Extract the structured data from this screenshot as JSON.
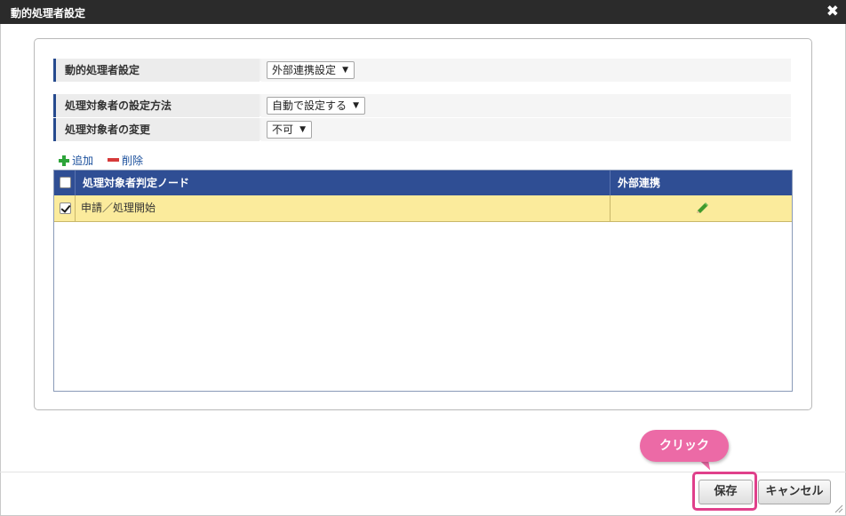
{
  "window": {
    "title": "動的処理者設定",
    "close_glyph": "✖"
  },
  "form": {
    "dynamic_processor": {
      "label": "動的処理者設定",
      "value": "外部連携設定"
    },
    "target_method": {
      "label": "処理対象者の設定方法",
      "value": "自動で設定する"
    },
    "target_change": {
      "label": "処理対象者の変更",
      "value": "不可"
    }
  },
  "toolbar": {
    "add_label": "追加",
    "delete_label": "削除"
  },
  "grid": {
    "columns": [
      "処理対象者判定ノード",
      "外部連携"
    ],
    "rows": [
      {
        "checked": true,
        "node": "申請／処理開始",
        "action_icon": "pencil-icon"
      }
    ]
  },
  "callout": {
    "text": "クリック"
  },
  "footer": {
    "save_label": "保存",
    "cancel_label": "キャンセル"
  },
  "colors": {
    "titlebar": "#2b2b2b",
    "grid_header": "#2f4e94",
    "selected_row": "#fbeb9c",
    "callout": "#ec6aa6",
    "highlight_border": "#e0408b"
  }
}
